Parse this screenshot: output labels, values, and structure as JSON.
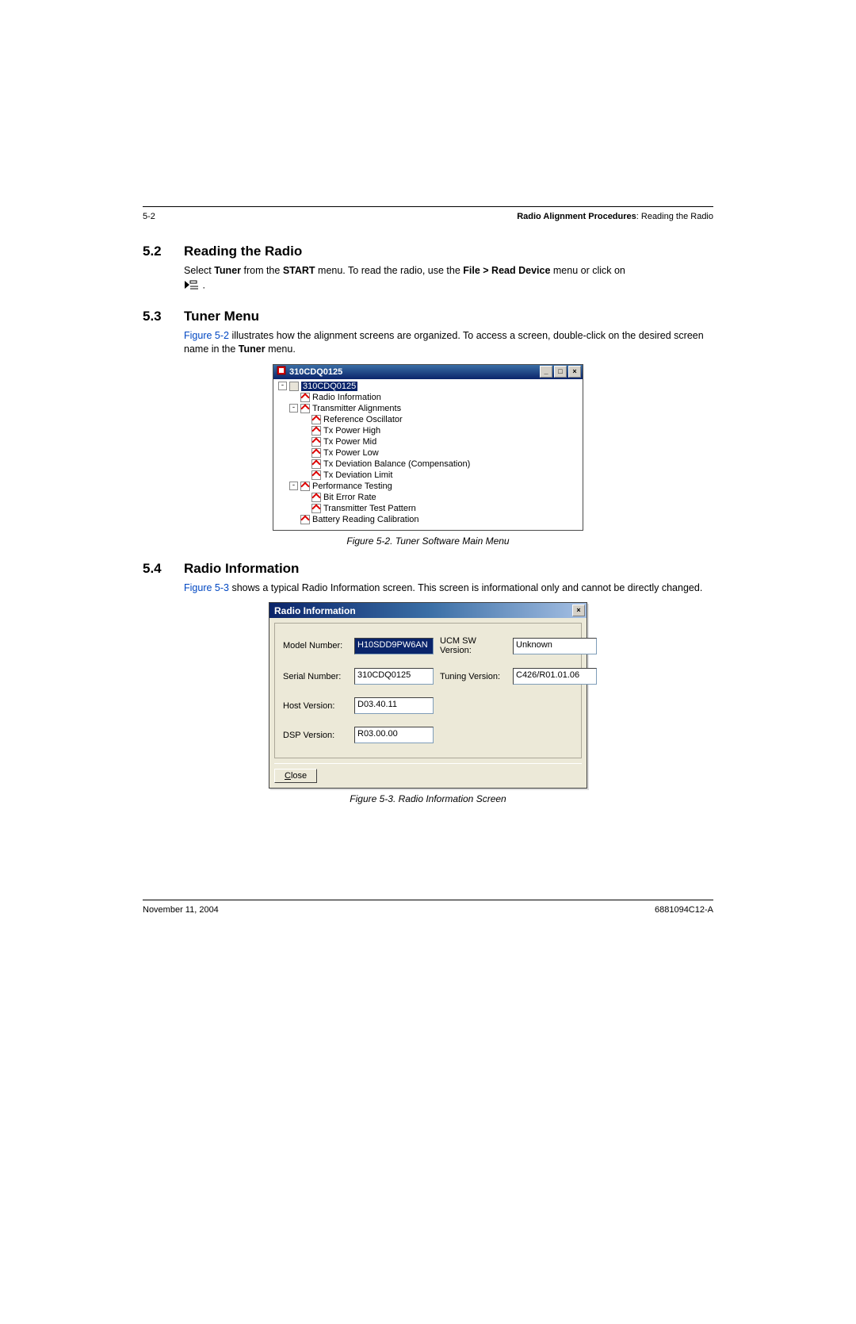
{
  "header": {
    "page_num": "5-2",
    "doc_section_bold": "Radio Alignment Procedures",
    "doc_section_tail": ": Reading the Radio"
  },
  "sections": {
    "s1": {
      "num": "5.2",
      "title": "Reading the Radio"
    },
    "s2": {
      "num": "5.3",
      "title": "Tuner Menu"
    },
    "s3": {
      "num": "5.4",
      "title": "Radio Information"
    }
  },
  "para": {
    "p1a": "Select ",
    "p1b_bold": "Tuner",
    "p1c": " from the ",
    "p1d_bold": "START",
    "p1e": " menu. To read the radio, use the ",
    "p1f_bold": "File > Read Device",
    "p1g": " menu or click on",
    "p1h": " .",
    "p2_ref": "Figure 5-2",
    "p2a": " illustrates how the alignment screens are organized. To access a screen, double-click on the desired screen name in the ",
    "p2b_bold": "Tuner",
    "p2c": " menu.",
    "p3_ref": "Figure 5-3",
    "p3a": " shows a typical Radio Information screen. This screen is informational only and cannot be directly changed."
  },
  "tuner": {
    "title": "310CDQ0125",
    "root": "310CDQ0125",
    "items": [
      "Radio Information",
      "Transmitter Alignments",
      "Reference Oscillator",
      "Tx Power High",
      "Tx Power Mid",
      "Tx Power Low",
      "Tx Deviation Balance (Compensation)",
      "Tx Deviation Limit",
      "Performance Testing",
      "Bit Error Rate",
      "Transmitter Test Pattern",
      "Battery Reading Calibration"
    ],
    "caption": "Figure 5-2.  Tuner Software Main Menu"
  },
  "radio_info": {
    "title": "Radio Information",
    "labels": {
      "model": "Model Number:",
      "serial": "Serial Number:",
      "host": "Host Version:",
      "dsp": "DSP Version:",
      "ucm": "UCM SW Version:",
      "tuning": "Tuning Version:"
    },
    "values": {
      "model": "H10SDD9PW6AN",
      "serial": "310CDQ0125",
      "host": "D03.40.11",
      "dsp": "R03.00.00",
      "ucm": "Unknown",
      "tuning": "C426/R01.01.06"
    },
    "close_u": "C",
    "close_rest": "lose",
    "caption": "Figure 5-3.  Radio Information Screen"
  },
  "footer": {
    "date": "November 11, 2004",
    "doc_id": "6881094C12-A"
  },
  "window_controls": {
    "min": "_",
    "max": "□",
    "close": "×"
  }
}
